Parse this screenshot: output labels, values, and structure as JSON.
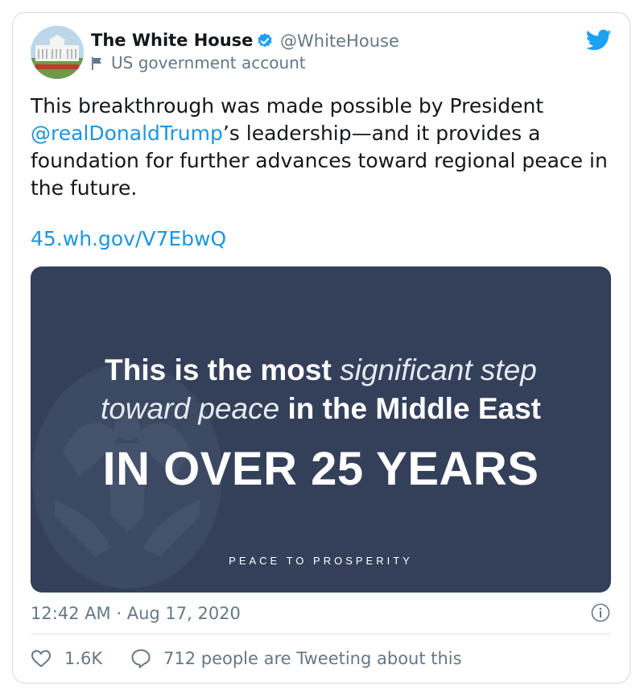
{
  "tweet": {
    "author_name": "The White House",
    "handle": "@WhiteHouse",
    "account_label": "US government account",
    "text_part1": "This breakthrough was made possible by President ",
    "mention": "@realDonaldTrump",
    "text_part2": "’s leadership—and it provides a foundation for further advances toward regional peace in the future.",
    "link": "45.wh.gov/V7EbwQ",
    "timestamp": "12:42 AM · Aug 17, 2020",
    "likes": "1.6K",
    "talking_about": "712 people are Tweeting about this"
  },
  "media": {
    "line1_bold": "This is the most ",
    "line1_italic": "significant step",
    "line2_italic": "toward peace ",
    "line2_bold": "in the Middle East",
    "line3": "IN OVER 25 YEARS",
    "footer": "PEACE TO PROSPERITY"
  },
  "colors": {
    "link_blue": "#1b95e0",
    "media_bg": "#34405a",
    "muted": "#657786"
  },
  "icons": [
    "verified-badge-icon",
    "flag-icon",
    "twitter-bird-icon",
    "info-icon",
    "heart-icon",
    "reply-bubble-icon"
  ]
}
